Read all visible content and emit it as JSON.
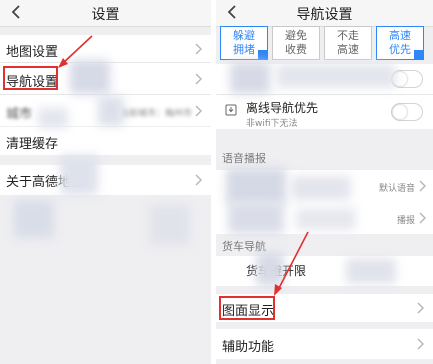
{
  "left": {
    "title": "设置",
    "items": [
      {
        "label": "地图设置"
      },
      {
        "label": "导航设置"
      },
      {
        "label": "城市",
        "value": "当前城市：梅州市"
      },
      {
        "label": "清理缓存"
      },
      {
        "label": "关于高德地图"
      }
    ]
  },
  "right": {
    "title": "导航设置",
    "route_options": [
      {
        "label": "躲避拥堵",
        "selected": true
      },
      {
        "label": "避免收费",
        "selected": false
      },
      {
        "label": "不走高速",
        "selected": false
      },
      {
        "label": "高速优先",
        "selected": true
      }
    ],
    "offline_nav": {
      "label": "离线导航优先",
      "sub": "非wifi下无法"
    },
    "voice_section": "语音播报",
    "voice_default": "默认语音",
    "voice_broadcast": "播报",
    "truck_section": "货车导航",
    "truck_item": "货车避开限",
    "display": "图面显示",
    "assist": "辅助功能"
  },
  "colors": {
    "accent": "#2f86f6",
    "highlight": "#e03030"
  }
}
